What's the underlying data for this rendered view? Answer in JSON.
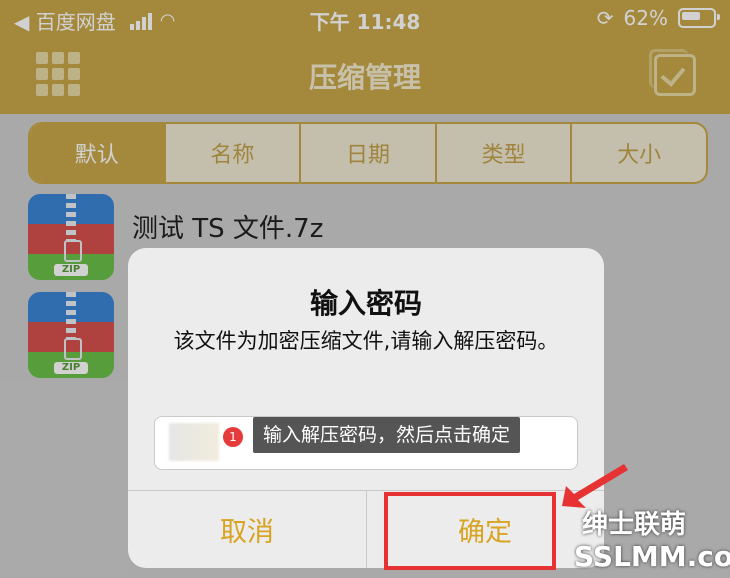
{
  "status": {
    "carrier": "◀ 百度网盘",
    "time": "下午 11:48",
    "battery": "62%"
  },
  "header": {
    "title": "压缩管理"
  },
  "sort_tabs": [
    "默认",
    "名称",
    "日期",
    "类型",
    "大小"
  ],
  "files": [
    {
      "name": "测试 TS 文件.7z",
      "icon_label": "ZIP"
    },
    {
      "name": "",
      "icon_label": "ZIP"
    }
  ],
  "dialog": {
    "title": "输入密码",
    "message": "该文件为加密压缩文件,请输入解压密码。",
    "input_placeholder": "",
    "badge": "1",
    "tip": "输入解压密码，然后点击确定",
    "cancel": "取消",
    "ok": "确定"
  },
  "watermark": {
    "line1": "绅士联萌",
    "line2": "SSLMM.com"
  },
  "colors": {
    "accent": "#c8a84a",
    "button": "#d9a421",
    "highlight": "#e63232"
  }
}
